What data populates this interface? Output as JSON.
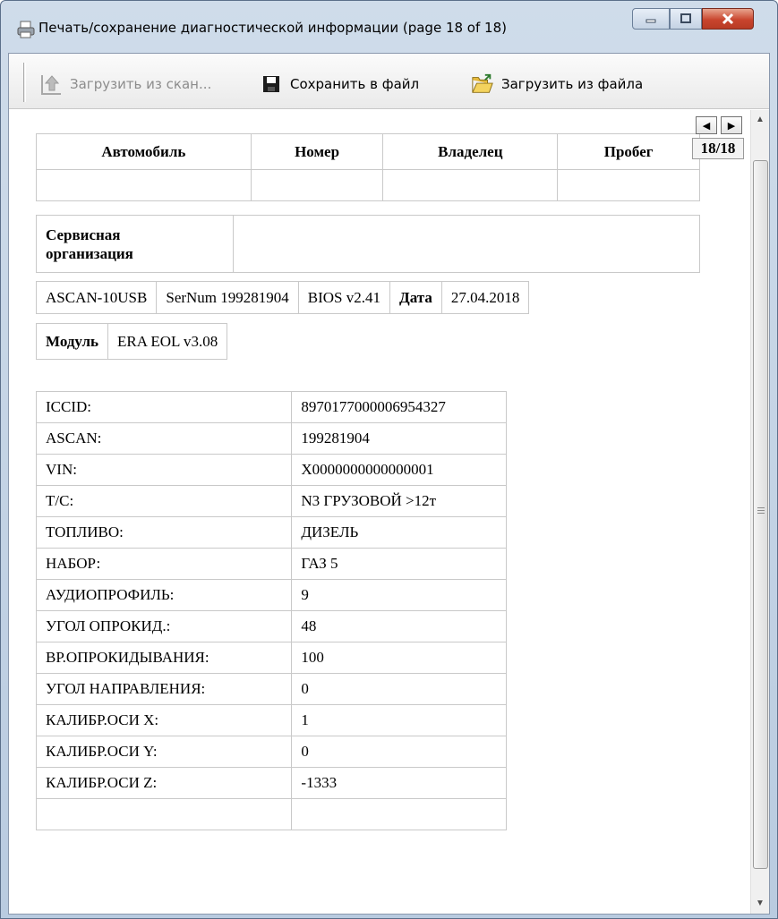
{
  "window": {
    "title": "Печать/сохранение диагностической информации (page 18 of 18)"
  },
  "toolbar": {
    "scan_label": "Загрузить из скан...",
    "save_label": "Сохранить в файл",
    "load_label": "Загрузить из файла"
  },
  "pager": {
    "prev": "◀",
    "next": "▶",
    "page": "18/18"
  },
  "vehicle_table": {
    "headers": [
      "Автомобиль",
      "Номер",
      "Владелец",
      "Пробег"
    ],
    "values": [
      "",
      "",
      "",
      ""
    ]
  },
  "service": {
    "label_line1": "Сервисная",
    "label_line2": "организация",
    "value": ""
  },
  "device": {
    "model": "ASCAN-10USB",
    "serial": "SerNum 199281904",
    "bios": "BIOS v2.41",
    "date_label": "Дата",
    "date": "27.04.2018"
  },
  "module": {
    "label": "Модуль",
    "value": "ERA EOL v3.08"
  },
  "params": [
    {
      "name": "ICCID:",
      "value": "89701770000069543​27"
    },
    {
      "name": "ASCAN:",
      "value": "199281904"
    },
    {
      "name": "VIN:",
      "value": "X0000000000000001"
    },
    {
      "name": "T/C:",
      "value": "N3 ГРУЗОВОЙ >12т"
    },
    {
      "name": "ТОПЛИВО:",
      "value": "ДИЗЕЛЬ"
    },
    {
      "name": "НАБОР:",
      "value": "ГАЗ 5"
    },
    {
      "name": "АУДИОПРОФИЛЬ:",
      "value": "9"
    },
    {
      "name": "УГОЛ ОПРОКИД.:",
      "value": "48"
    },
    {
      "name": "ВР.ОПРОКИДЫВАНИЯ:",
      "value": "100"
    },
    {
      "name": "УГОЛ НАПРАВЛЕНИЯ:",
      "value": "0"
    },
    {
      "name": "КАЛИБР.ОСИ X:",
      "value": "1"
    },
    {
      "name": "КАЛИБР.ОСИ Y:",
      "value": "0"
    },
    {
      "name": "КАЛИБР.ОСИ Z:",
      "value": "-1333"
    },
    {
      "name": "",
      "value": ""
    }
  ],
  "icons": {
    "title": "printer-icon",
    "scan": "scan-upload-icon",
    "save": "floppy-disk-icon",
    "load": "open-folder-icon"
  }
}
